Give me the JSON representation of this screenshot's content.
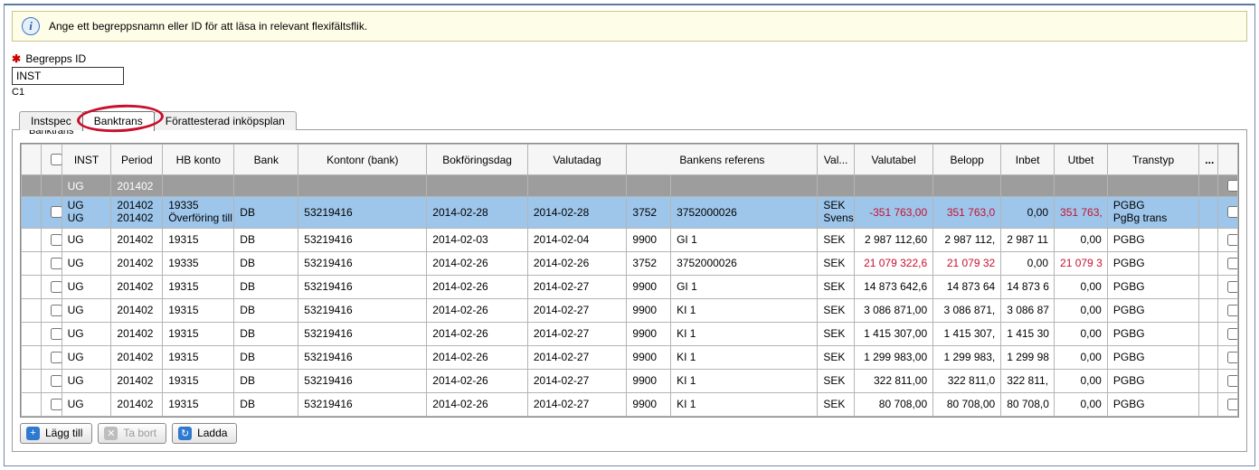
{
  "info_text": "Ange ett begreppsnamn eller ID för att läsa in relevant flexifältsflik.",
  "form": {
    "id_label": "Begrepps ID",
    "id_value": "INST",
    "sub_value": "C1"
  },
  "tabs": {
    "t0": "Instspec",
    "t1": "Banktrans",
    "t2": "Förattesterad inköpsplan"
  },
  "panel_title": "Banktrans",
  "columns": {
    "c1": "INST",
    "c2": "Period",
    "c3": "HB konto",
    "c4": "Bank",
    "c5": "Kontonr (bank)",
    "c6": "Bokföringsdag",
    "c7": "Valutadag",
    "c8": "Bankens referens",
    "c9": "Val...",
    "c10": "Valutabel",
    "c11": "Belopp",
    "c12": "Inbet",
    "c13": "Utbet",
    "c14": "Transtyp",
    "c15": "..."
  },
  "filter": {
    "inst": "UG",
    "period": "201402"
  },
  "rows": [
    {
      "selected": true,
      "inst_a": "UG",
      "inst_b": "UG",
      "period_a": "201402",
      "period_b": "201402",
      "hb_a": "19335",
      "hb_b": "Överföring till",
      "bank": "DB",
      "konto": "53219416",
      "bokdag": "2014-02-28",
      "valdag": "2014-02-28",
      "ref_a": "3752",
      "ref_b": "3752000026",
      "val_a": "SEK",
      "val_b": "Svens",
      "valbel": "-351 763,00",
      "valbel_red": true,
      "belopp": "351 763,0",
      "belopp_red": true,
      "inbet": "0,00",
      "utbet": "351 763,",
      "utbet_red": true,
      "trans_a": "PGBG",
      "trans_b": "PgBg trans"
    },
    {
      "inst_a": "UG",
      "period_a": "201402",
      "hb_a": "19315",
      "bank": "DB",
      "konto": "53219416",
      "bokdag": "2014-02-03",
      "valdag": "2014-02-04",
      "ref_a": "9900",
      "ref_b": "GI 1",
      "val_a": "SEK",
      "valbel": "2 987 112,60",
      "belopp": "2 987 112,",
      "inbet": "2 987 11",
      "utbet": "0,00",
      "trans_a": "PGBG"
    },
    {
      "inst_a": "UG",
      "period_a": "201402",
      "hb_a": "19335",
      "bank": "DB",
      "konto": "53219416",
      "bokdag": "2014-02-26",
      "valdag": "2014-02-26",
      "ref_a": "3752",
      "ref_b": "3752000026",
      "val_a": "SEK",
      "valbel": "21 079 322,6",
      "valbel_red": true,
      "belopp": "21 079 32",
      "belopp_red": true,
      "inbet": "0,00",
      "utbet": "21 079 3",
      "utbet_red": true,
      "trans_a": "PGBG"
    },
    {
      "inst_a": "UG",
      "period_a": "201402",
      "hb_a": "19315",
      "bank": "DB",
      "konto": "53219416",
      "bokdag": "2014-02-26",
      "valdag": "2014-02-27",
      "ref_a": "9900",
      "ref_b": "GI 1",
      "val_a": "SEK",
      "valbel": "14 873 642,6",
      "belopp": "14 873 64",
      "inbet": "14 873 6",
      "utbet": "0,00",
      "trans_a": "PGBG"
    },
    {
      "inst_a": "UG",
      "period_a": "201402",
      "hb_a": "19315",
      "bank": "DB",
      "konto": "53219416",
      "bokdag": "2014-02-26",
      "valdag": "2014-02-27",
      "ref_a": "9900",
      "ref_b": "KI 1",
      "val_a": "SEK",
      "valbel": "3 086 871,00",
      "belopp": "3 086 871,",
      "inbet": "3 086 87",
      "utbet": "0,00",
      "trans_a": "PGBG"
    },
    {
      "inst_a": "UG",
      "period_a": "201402",
      "hb_a": "19315",
      "bank": "DB",
      "konto": "53219416",
      "bokdag": "2014-02-26",
      "valdag": "2014-02-27",
      "ref_a": "9900",
      "ref_b": "KI 1",
      "val_a": "SEK",
      "valbel": "1 415 307,00",
      "belopp": "1 415 307,",
      "inbet": "1 415 30",
      "utbet": "0,00",
      "trans_a": "PGBG"
    },
    {
      "inst_a": "UG",
      "period_a": "201402",
      "hb_a": "19315",
      "bank": "DB",
      "konto": "53219416",
      "bokdag": "2014-02-26",
      "valdag": "2014-02-27",
      "ref_a": "9900",
      "ref_b": "KI 1",
      "val_a": "SEK",
      "valbel": "1 299 983,00",
      "belopp": "1 299 983,",
      "inbet": "1 299 98",
      "utbet": "0,00",
      "trans_a": "PGBG"
    },
    {
      "inst_a": "UG",
      "period_a": "201402",
      "hb_a": "19315",
      "bank": "DB",
      "konto": "53219416",
      "bokdag": "2014-02-26",
      "valdag": "2014-02-27",
      "ref_a": "9900",
      "ref_b": "KI 1",
      "val_a": "SEK",
      "valbel": "322 811,00",
      "belopp": "322 811,0",
      "inbet": "322 811,",
      "utbet": "0,00",
      "trans_a": "PGBG"
    },
    {
      "inst_a": "UG",
      "period_a": "201402",
      "hb_a": "19315",
      "bank": "DB",
      "konto": "53219416",
      "bokdag": "2014-02-26",
      "valdag": "2014-02-27",
      "ref_a": "9900",
      "ref_b": "KI 1",
      "val_a": "SEK",
      "valbel": "80 708,00",
      "belopp": "80 708,00",
      "inbet": "80 708,0",
      "utbet": "0,00",
      "trans_a": "PGBG"
    }
  ],
  "buttons": {
    "add": "Lägg till",
    "remove": "Ta bort",
    "load": "Ladda"
  }
}
